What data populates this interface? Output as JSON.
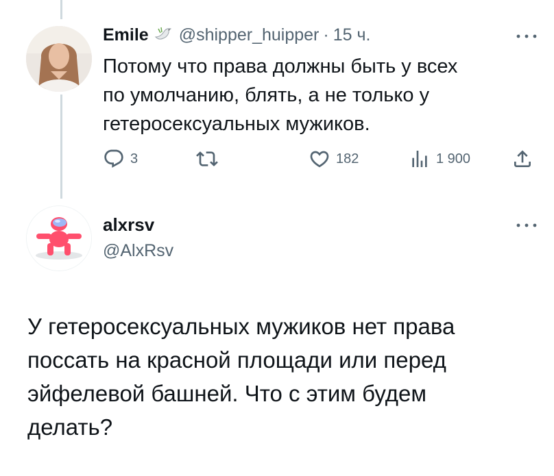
{
  "reply_tweet": {
    "author_name": "Emile",
    "author_handle": "@shipper_huipper",
    "separator": "·",
    "time": "15 ч.",
    "text_lines": [
      "Потому что права должны быть у всех",
      "по умолчанию, блять, а не только у",
      "гетеросексуальных мужиков."
    ],
    "actions": {
      "replies": "3",
      "retweets": "",
      "likes": "182",
      "views": "1 900"
    },
    "badge_icon": "dove-icon"
  },
  "main_tweet": {
    "author_name": "alxrsv",
    "author_handle": "@AlxRsv",
    "text_lines": [
      "У гетеросексуальных мужиков нет права",
      "поссать на красной площади или перед",
      "эйфелевой башней. Что с этим будем",
      "делать?"
    ]
  },
  "colors": {
    "text_primary": "#0f1419",
    "text_secondary": "#536471",
    "thread_line": "#cfd9de",
    "avatar2_figure": "#ff4f6d"
  }
}
